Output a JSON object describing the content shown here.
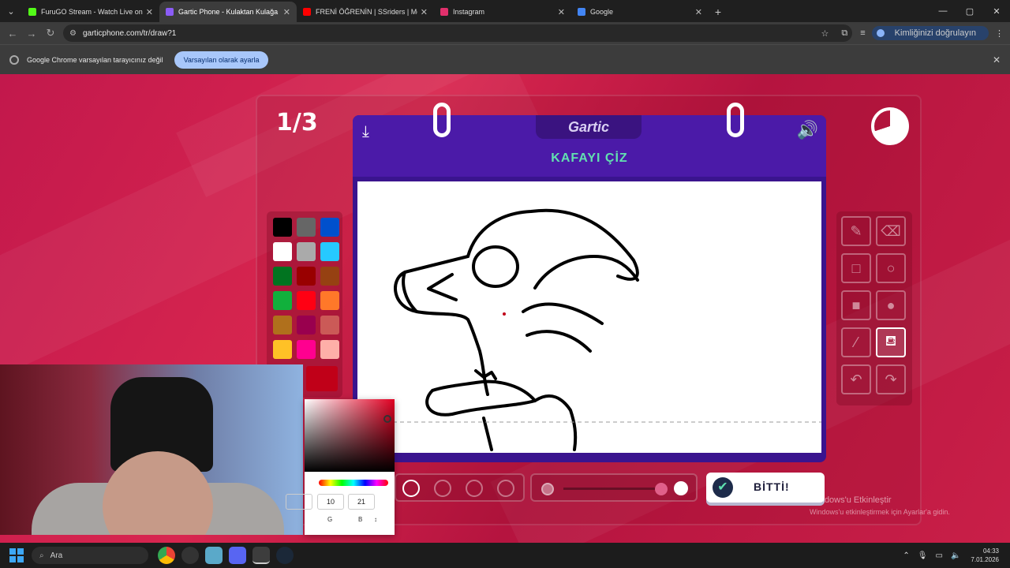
{
  "browser": {
    "tabs": [
      {
        "title": "FuruGO Stream - Watch Live on",
        "color": "#53fc18",
        "active": false
      },
      {
        "title": "Gartic Phone - Kulaktan Kulağa",
        "color": "#8b5cf6",
        "active": true
      },
      {
        "title": "FRENİ ÖĞRENİN | SSriders | Mo",
        "color": "#ff0000",
        "active": false
      },
      {
        "title": "Instagram",
        "color": "#e1306c",
        "active": false
      },
      {
        "title": "Google",
        "color": "#4285f4",
        "active": false
      }
    ],
    "url": "garticphone.com/tr/draw?1",
    "profile_label": "Kimliğinizi doğrulayın",
    "infobar": {
      "message": "Google Chrome varsayılan tarayıcınız değil",
      "button": "Varsayılan olarak ayarla"
    }
  },
  "game": {
    "round": "1/3",
    "logo": "Gartic",
    "prompt": "KAFAYI ÇİZ",
    "done_label": "BİTTİ!",
    "palette": [
      "#000000",
      "#666666",
      "#0050cd",
      "#ffffff",
      "#aaaaaa",
      "#26c9ff",
      "#017420",
      "#990000",
      "#964112",
      "#11b03c",
      "#ff0013",
      "#ff7829",
      "#b0701c",
      "#99004e",
      "#cb5a57",
      "#ffc126",
      "#ff008f",
      "#feafa8"
    ],
    "selected_color": "#c00018",
    "tools": [
      "pencil-icon",
      "eraser-icon",
      "square-outline-icon",
      "circle-outline-icon",
      "square-fill-icon",
      "circle-fill-icon",
      "line-icon",
      "bucket-icon",
      "undo-icon",
      "redo-icon"
    ],
    "selected_tool": "bucket-icon"
  },
  "color_picker": {
    "r": "",
    "g": "10",
    "b": "21",
    "label_g": "G",
    "label_b": "B"
  },
  "windows": {
    "activate_title": "Windows'u Etkinleştir",
    "activate_sub": "Windows'u etkinleştirmek için Ayarlar'a gidin.",
    "search_placeholder": "Ara",
    "time": "04:33",
    "date": "7.01.2026"
  }
}
